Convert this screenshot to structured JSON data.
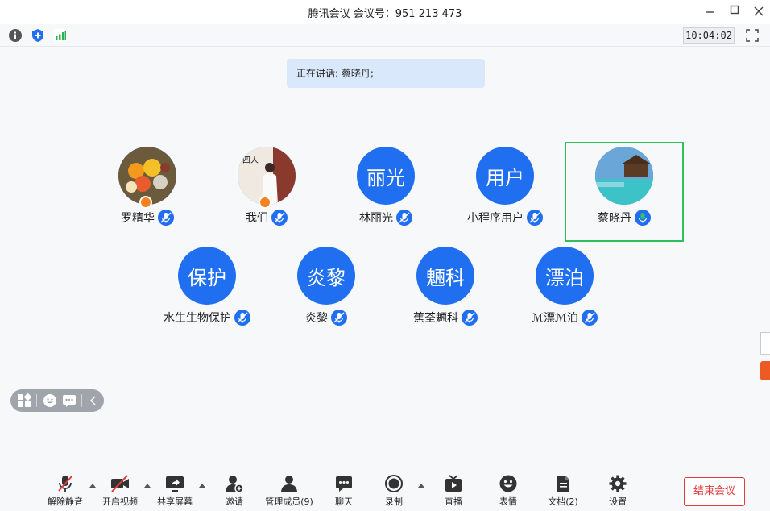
{
  "window": {
    "title": "腾讯会议 会议号：951 213 473",
    "minimize_icon": "minimize-icon",
    "maximize_icon": "maximize-icon",
    "close_icon": "close-icon"
  },
  "status": {
    "clock": "10:04:02",
    "icons": [
      "info-icon",
      "shield-icon",
      "signal-icon",
      "fullscreen-icon"
    ]
  },
  "speaking": {
    "text": "正在讲话: 蔡晓丹;"
  },
  "participants": [
    {
      "name": "罗精华",
      "avatar": "photo-fruit",
      "host": true,
      "mic": "muted",
      "active": false
    },
    {
      "name": "我们",
      "avatar": "photo-person",
      "host": true,
      "mic": "muted",
      "active": false
    },
    {
      "name": "林丽光",
      "avatar_text": "丽光",
      "mic": "muted",
      "active": false
    },
    {
      "name": "小程序用户",
      "avatar_text": "用户",
      "mic": "muted",
      "active": false
    },
    {
      "name": "蔡晓丹",
      "avatar": "photo-sea",
      "mic": "speaking",
      "active": true
    },
    {
      "name": "水生生物保护",
      "avatar_text": "保护",
      "mic": "muted",
      "active": false
    },
    {
      "name": "炎黎",
      "avatar_text": "炎黎",
      "mic": "muted",
      "active": false
    },
    {
      "name": "蕉荃魎科",
      "avatar_text": "魎科",
      "mic": "muted",
      "active": false
    },
    {
      "name": "ℳ漂ℳ泊",
      "avatar_text": "漂泊",
      "mic": "muted",
      "active": false
    }
  ],
  "toolbar": {
    "unmute": "解除静音",
    "video": "开启视频",
    "share": "共享屏幕",
    "invite": "邀请",
    "members": "管理成员(9)",
    "chat": "聊天",
    "record": "录制",
    "live": "直播",
    "emoji": "表情",
    "docs": "文档(2)",
    "settings": "设置",
    "end": "结束会议"
  },
  "colors": {
    "accent": "#1f6ff0",
    "active_border": "#2fbf5b",
    "speaking_bg": "#d9e9fb",
    "end": "#e23b3b",
    "host_badge": "#f58220"
  }
}
